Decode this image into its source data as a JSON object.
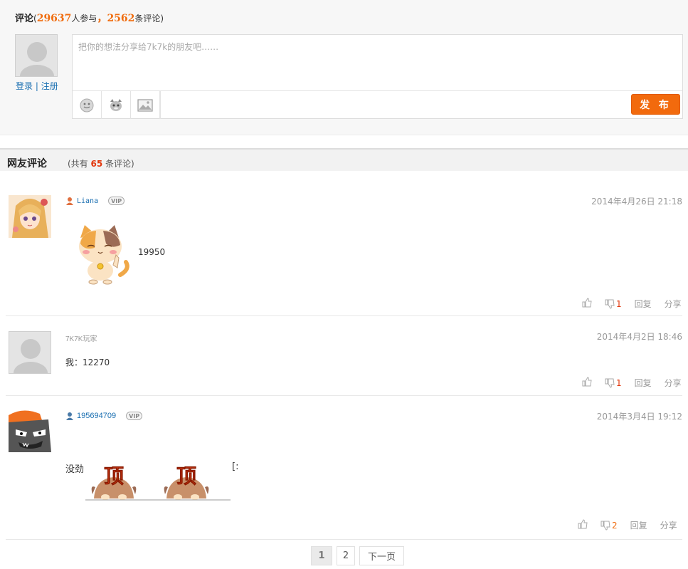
{
  "comment_box": {
    "title": "评论",
    "open_paren": "(",
    "participants": "29637",
    "participants_suffix": "人参与",
    "sep": "，",
    "comments_count": "2562",
    "comments_suffix": "条评论)",
    "login": "登录",
    "login_sep": " | ",
    "register": "注册",
    "placeholder": "把你的想法分享给7k7k的朋友吧……",
    "tools": [
      "smiley-icon",
      "cat-sticker-icon",
      "image-icon"
    ],
    "publish_label": "发 布"
  },
  "section": {
    "title": "网友评论",
    "count_prefix": "(共有",
    "count": "65",
    "count_suffix": "条评论)"
  },
  "comments": [
    {
      "username": "Liana",
      "vip": "VIP",
      "time": "2014年4月26日 21:18",
      "text": "19950",
      "down": "1",
      "reply": "回复",
      "share": "分享"
    },
    {
      "username": "7K7K玩家",
      "time": "2014年4月2日 18:46",
      "text": "我：12270",
      "down": "1",
      "reply": "回复",
      "share": "分享"
    },
    {
      "username": "195694709",
      "vip": "VIP",
      "time": "2014年3月4日 19:12",
      "text": "没劲",
      "trailing": "[:",
      "sticker_text": "顶",
      "down": "2",
      "reply": "回复",
      "share": "分享"
    }
  ],
  "pagination": {
    "current": "1",
    "page2": "2",
    "next": "下一页"
  },
  "colors": {
    "accent": "#f26a0d",
    "link": "#1a6fb1",
    "count_red": "#e2380e"
  }
}
